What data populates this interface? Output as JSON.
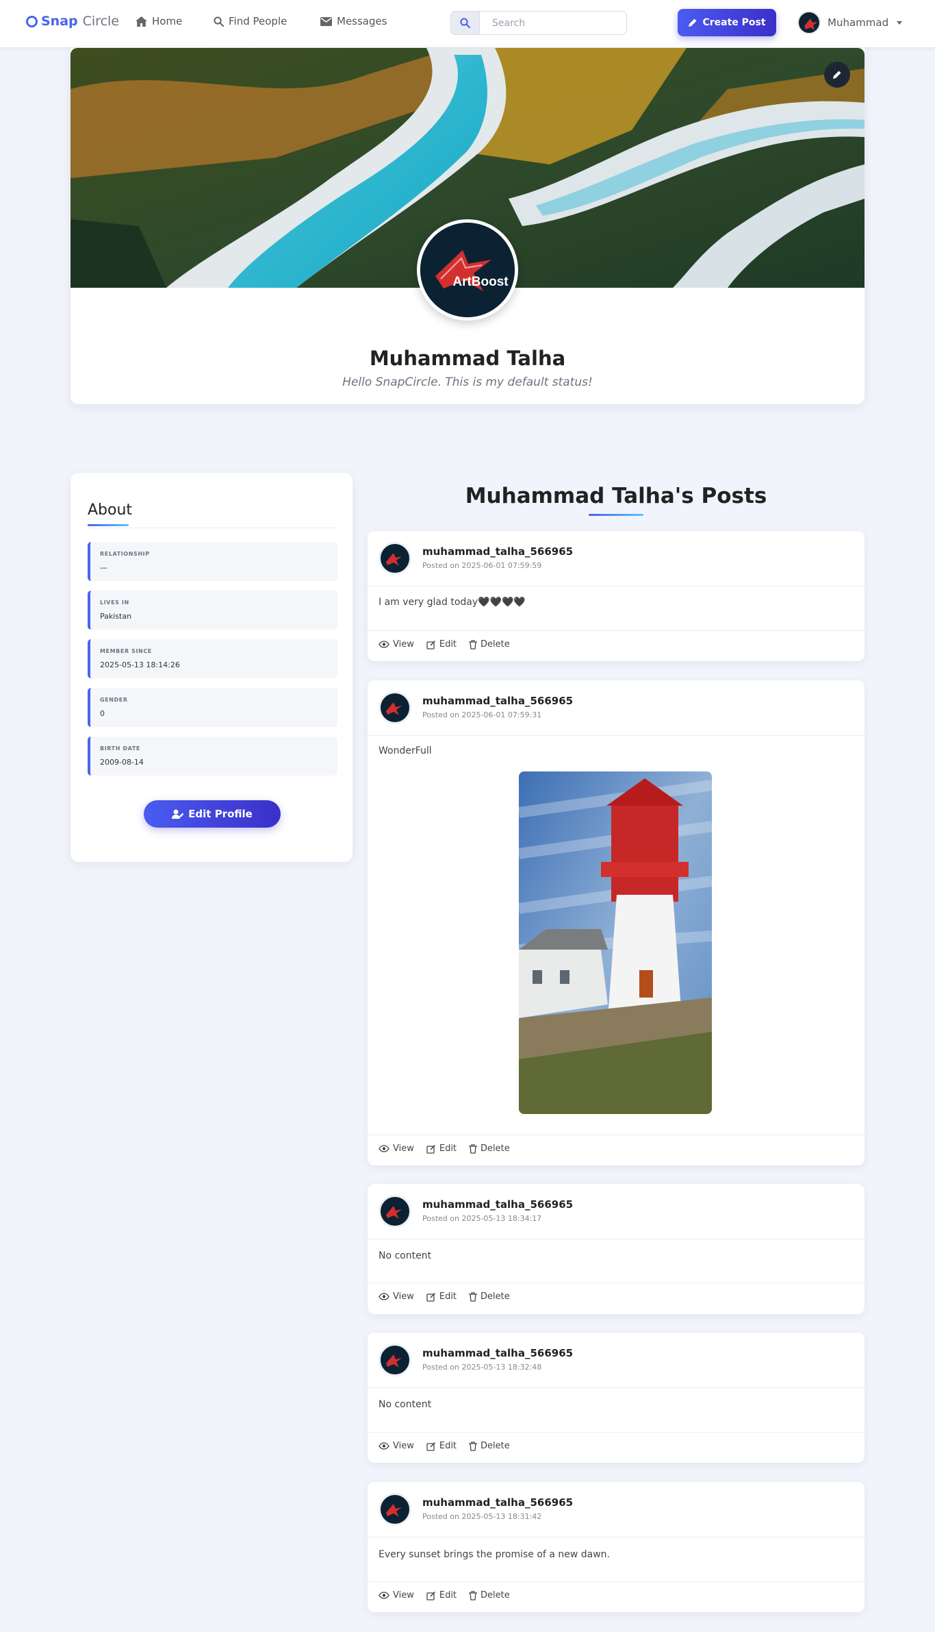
{
  "nav": {
    "brand_part1": "Snap",
    "brand_part2": "Circle",
    "links": [
      "Home",
      "Find People",
      "Messages"
    ],
    "search_placeholder": "Search",
    "search_value": "",
    "create_post_label": "Create Post",
    "user_name": "Muhammad"
  },
  "profile": {
    "name": "Muhammad Talha",
    "status": "Hello SnapCircle. This is my default status!",
    "avatar_logo_text": "ArtBoost"
  },
  "about": {
    "title": "About",
    "fields": [
      {
        "label": "RELATIONSHIP",
        "value": "—"
      },
      {
        "label": "LIVES IN",
        "value": "Pakistan"
      },
      {
        "label": "MEMBER SINCE",
        "value": "2025-05-13 18:14:26"
      },
      {
        "label": "GENDER",
        "value": "0"
      },
      {
        "label": "BIRTH DATE",
        "value": "2009-08-14"
      }
    ],
    "edit_profile_label": "Edit Profile"
  },
  "posts_title": "Muhammad Talha's Posts",
  "posts": [
    {
      "username": "muhammad_talha_566965",
      "date": "Posted on 2025-06-01 07:59:59",
      "content": "I am very glad today🖤🖤🖤🖤",
      "has_image": false
    },
    {
      "username": "muhammad_talha_566965",
      "date": "Posted on 2025-06-01 07:59:31",
      "content": "WonderFull",
      "has_image": true
    },
    {
      "username": "muhammad_talha_566965",
      "date": "Posted on 2025-05-13 18:34:17",
      "content": "No content",
      "has_image": false
    },
    {
      "username": "muhammad_talha_566965",
      "date": "Posted on 2025-05-13 18:32:48",
      "content": "No content",
      "has_image": false
    },
    {
      "username": "muhammad_talha_566965",
      "date": "Posted on 2025-05-13 18:31:42",
      "content": "Every sunset brings the promise of a new dawn.",
      "has_image": false
    }
  ],
  "post_actions": {
    "view": "View",
    "edit": "Edit",
    "delete": "Delete"
  },
  "colors": {
    "accent": "#4a63ec",
    "button_gradient_end": "#3b2fc9",
    "page_bg": "#f1f4fb"
  },
  "icons": [
    "home-icon",
    "search-icon",
    "envelope-icon",
    "pencil-icon",
    "chevron-down-icon",
    "user-edit-icon",
    "eye-icon",
    "edit-icon",
    "trash-icon"
  ]
}
